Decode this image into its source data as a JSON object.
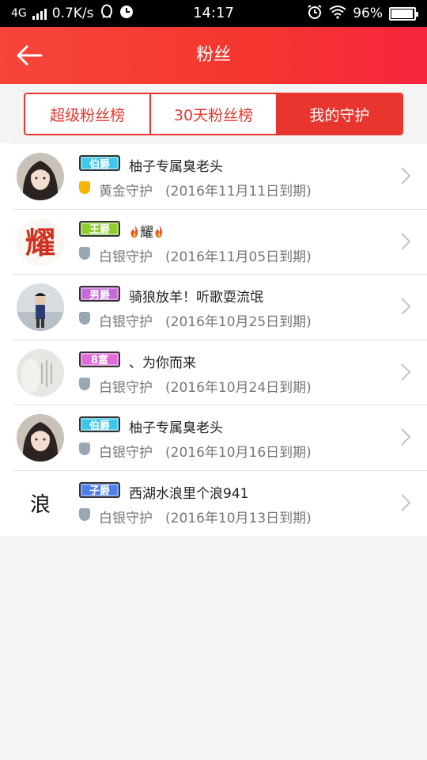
{
  "status_bar": {
    "network": "4G",
    "speed": "0.7K/s",
    "time": "14:17",
    "battery": "96%",
    "battery_level": 0.96
  },
  "header": {
    "title": "粉丝",
    "back_icon": "arrow-left-icon"
  },
  "tabs": [
    {
      "label": "超级粉丝榜",
      "active": false
    },
    {
      "label": "30天粉丝榜",
      "active": false
    },
    {
      "label": "我的守护",
      "active": true
    }
  ],
  "guards": [
    {
      "badge": "伯爵",
      "badge_color": "#3ec7e8",
      "name": "柚子专属臭老头",
      "guard_type": "黄金守护",
      "guard_color": "#f5b400",
      "expiry": "(2016年11月11日到期)",
      "avatar": "photo-girl"
    },
    {
      "badge": "王爵",
      "badge_color": "#8fce2e",
      "name": "耀",
      "name_flame": true,
      "guard_type": "白银守护",
      "guard_color": "#9aa6b2",
      "expiry": "(2016年11月05日到期)",
      "avatar": "calligraphy-yao"
    },
    {
      "badge": "男爵",
      "badge_color": "#c46ad6",
      "name": "骑狼放羊！听歌耍流氓",
      "guard_type": "白银守护",
      "guard_color": "#9aa6b2",
      "expiry": "(2016年10月25日到期)",
      "avatar": "photo-man"
    },
    {
      "badge": "8富",
      "badge_color": "#e06ad8",
      "name": "、为你而来",
      "guard_type": "白银守护",
      "guard_color": "#9aa6b2",
      "expiry": "(2016年10月24日到期)",
      "avatar": "photo-text"
    },
    {
      "badge": "伯爵",
      "badge_color": "#3ec7e8",
      "name": "柚子专属臭老头",
      "guard_type": "白银守护",
      "guard_color": "#9aa6b2",
      "expiry": "(2016年10月16日到期)",
      "avatar": "photo-girl"
    },
    {
      "badge": "子爵",
      "badge_color": "#4d7fe8",
      "name": "西湖水浪里个浪941",
      "guard_type": "白银守护",
      "guard_color": "#9aa6b2",
      "expiry": "(2016年10月13日到期)",
      "avatar": "calligraphy-lang"
    }
  ]
}
